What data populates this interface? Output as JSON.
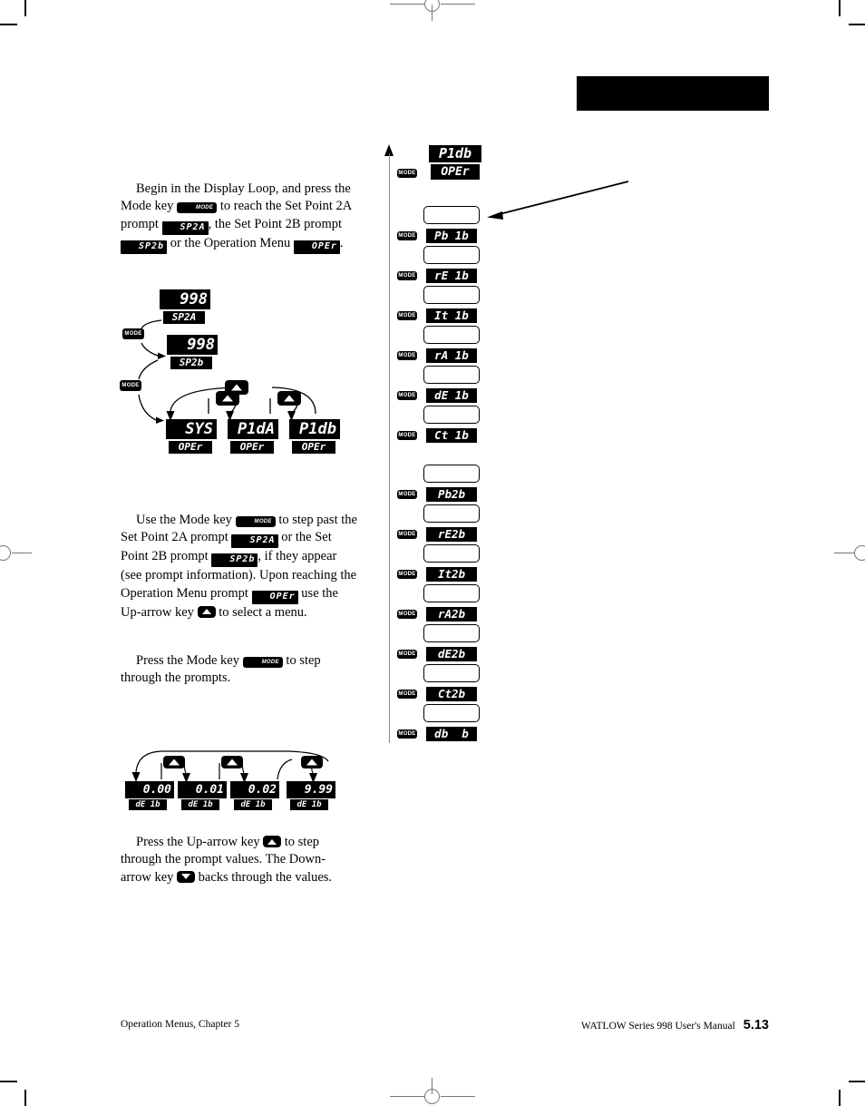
{
  "page": {
    "footer_left": "Operation Menus, Chapter 5",
    "footer_manual": "WATLOW Series 998 User's Manual",
    "footer_page": "5.13"
  },
  "keys": {
    "mode": "MODE",
    "up_arrow_name": "up-arrow-key",
    "down_arrow_name": "down-arrow-key"
  },
  "paragraphs": {
    "p1": {
      "t1": "Begin in the Display Loop, and press the Mode key ",
      "mode": "MODE",
      "t2": " to reach the Set Point 2A prompt ",
      "lcd1": "SP2A",
      "t3": ", the Set Point 2B prompt ",
      "lcd2": "SP2b",
      "t4": " or the Operation Menu ",
      "lcd3": "OPEr",
      "t5": "."
    },
    "p2": {
      "t1": "Use the Mode key ",
      "mode": "MODE",
      "t2": " to step past the Set Point 2A prompt ",
      "lcd1": "SP2A",
      "t3": " or the Set Point 2B prompt ",
      "lcd2": "SP2b",
      "t4": ", if they appear (see prompt information). Upon reaching the Operation Menu prompt ",
      "lcd3": "OPEr",
      "t5": " use the Up-arrow key ",
      "t6": " to select a menu."
    },
    "p3": {
      "t1": "Press the Mode key ",
      "mode": "MODE",
      "t2": " to step through the prompts."
    },
    "p4": {
      "t1": "Press the Up-arrow key ",
      "t2": " to step through the prompt values. The Down-arrow key ",
      "t3": " backs through the values."
    }
  },
  "display_loop": {
    "sp2a": {
      "value": "998",
      "label": "SP2A"
    },
    "sp2b": {
      "value": "998",
      "label": "SP2b"
    },
    "menus": [
      {
        "value": "SYS",
        "label": "OPEr"
      },
      {
        "value": "P1dA",
        "label": "OPEr"
      },
      {
        "value": "P1db",
        "label": "OPEr"
      }
    ],
    "mode_label": "MODE"
  },
  "prompt_column": {
    "mode_label": "MODE",
    "head": {
      "value": "P1db",
      "label": "OPEr"
    },
    "group1": [
      {
        "value": "",
        "label": "Pb 1b"
      },
      {
        "value": "",
        "label": "rE 1b"
      },
      {
        "value": "",
        "label": "It 1b"
      },
      {
        "value": "",
        "label": "rA 1b"
      },
      {
        "value": "",
        "label": "dE 1b"
      },
      {
        "value": "",
        "label": "Ct 1b"
      }
    ],
    "group2": [
      {
        "value": "",
        "label": "Pb2b"
      },
      {
        "value": "",
        "label": "rE2b"
      },
      {
        "value": "",
        "label": "It2b"
      },
      {
        "value": "",
        "label": "rA2b"
      },
      {
        "value": "",
        "label": "dE2b"
      },
      {
        "value": "",
        "label": "Ct2b"
      },
      {
        "value": "",
        "label": "db  b"
      }
    ]
  },
  "value_steps": [
    {
      "value": "0.00",
      "label": "dE 1b"
    },
    {
      "value": "0.01",
      "label": "dE 1b"
    },
    {
      "value": "0.02",
      "label": "dE 1b"
    },
    {
      "value": "9.99",
      "label": "dE 1b"
    }
  ]
}
